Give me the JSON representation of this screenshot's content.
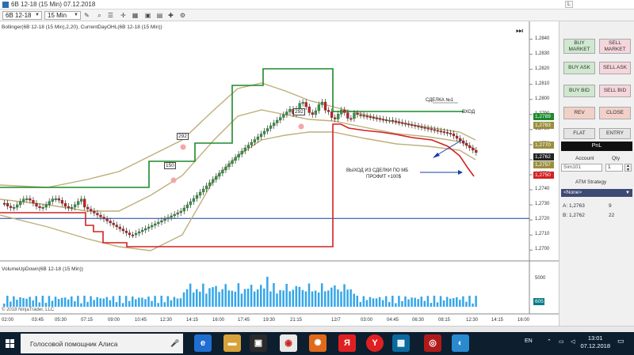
{
  "window": {
    "title": "6B 12-18 (15 Min)  07.12.2018"
  },
  "toolbar": {
    "instrument": "6B 12-18",
    "interval": "15 Min"
  },
  "chart": {
    "indicator_label": "Bollinger(6B 12-18 (15 Min),2,20), CurrentDayOHL(6B 12-18 (15 Min))",
    "volume_label": "VolumeUpDown(6B 12-18 (15 Min))",
    "copyright": "© 2018 NinjaTrader, LLC",
    "annotations": {
      "deal": "СДЕЛКА №1",
      "entry": "ВХОД",
      "exit_line1": "ВЫХОД ИЗ СДЕЛКИ ПО МБ",
      "exit_line2": "ПРОФИТ +100$",
      "box1": "292",
      "box2": "150",
      "box3": "292"
    },
    "price_ticks": [
      "1,2840",
      "1,2830",
      "1,2820",
      "1,2810",
      "1,2800",
      "1,2790",
      "1,2780",
      "1,2770",
      "1,2760",
      "1,2750",
      "1,2740",
      "1,2730",
      "1,2720",
      "1,2710",
      "1,2700"
    ],
    "price_tags": [
      {
        "label": "1,2789",
        "color": "#1c8a2a"
      },
      {
        "label": "1,2783",
        "color": "#9b8f3e"
      },
      {
        "label": "1,2770",
        "color": "#9b8f3e"
      },
      {
        "label": "1,2762",
        "color": "#222222"
      },
      {
        "label": "1,2757",
        "color": "#9b8f3e"
      },
      {
        "label": "1,2750",
        "color": "#d32121"
      }
    ],
    "volume_ticks": [
      "5000",
      "0"
    ],
    "volume_tag": "605",
    "time_ticks": [
      "02:00",
      "03:45",
      "05:30",
      "07:15",
      "09:00",
      "10:45",
      "12:30",
      "14:15",
      "16:00",
      "17:45",
      "19:30",
      "21:15",
      "12/7",
      "03:00",
      "04:45",
      "06:30",
      "08:15",
      "12:30",
      "14:15",
      "16:00"
    ]
  },
  "chart_data": {
    "type": "candlestick",
    "instrument": "6B 12-18",
    "interval": "15 Min",
    "ylim": [
      1.2697,
      1.2845
    ],
    "high_line_color": "#1c8a2a",
    "low_line_color": "#d32121",
    "bollinger_color": "#bfae78",
    "horizontal_line_color": "#1a3fa6",
    "horizontal_line": 1.2721
  },
  "panel": {
    "buy_market": "BUY\nMARKET",
    "sell_market": "SELL\nMARKET",
    "buy_ask": "BUY ASK",
    "sell_ask": "SELL ASK",
    "buy_bid": "BUY BID",
    "sell_bid": "SELL BID",
    "rev": "REV",
    "close": "CLOSE",
    "flat": "FLAT",
    "entry": "ENTRY",
    "pnl": "PnL",
    "account_label": "Account",
    "qty_label": "Qty",
    "account_value": "Sim101",
    "qty_value": "1",
    "atm_strategy": "ATM Strategy",
    "atm_value": "<None>",
    "ask_label": "A: 1,2763",
    "ask_size": "9",
    "bid_label": "B: 1,2762",
    "bid_size": "22"
  },
  "taskbar": {
    "search_text": "Голосовой помощник Алиса",
    "lang": "EN",
    "time": "13:01",
    "date": "07.12.2018"
  }
}
